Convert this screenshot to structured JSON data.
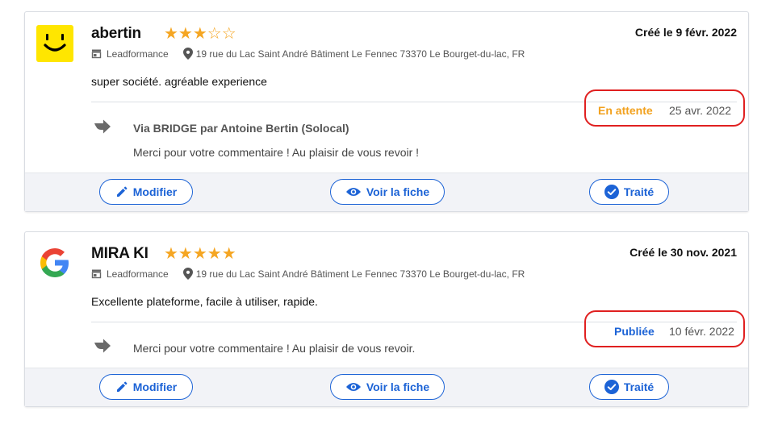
{
  "colors": {
    "accent": "#1c63d6",
    "pending": "#f2a11e",
    "highlight": "#e02020",
    "star": "#f5a623"
  },
  "reviews": [
    {
      "author": "abertin",
      "source_icon": "smiley-logo-icon",
      "rating": 3,
      "rating_max": 5,
      "stars_display": {
        "full": "★★★",
        "empty": "☆☆"
      },
      "created": "Créé le 9 févr. 2022",
      "location_name": "Leadformance",
      "address": "19 rue du Lac Saint André Bâtiment Le Fennec 73370 Le Bourget-du-lac, FR",
      "text": "super société. agréable experience",
      "reply": {
        "status": "En attente",
        "date": "25 avr. 2022",
        "via": "Via BRIDGE par Antoine Bertin (Solocal)",
        "text": "Merci pour votre commentaire ! Au plaisir de vous revoir !"
      }
    },
    {
      "author": "MIRA KI",
      "source_icon": "google-logo-icon",
      "rating": 5,
      "rating_max": 5,
      "stars_display": {
        "full": "★★★★★",
        "empty": ""
      },
      "created": "Créé le 30 nov. 2021",
      "location_name": "Leadformance",
      "address": "19 rue du Lac Saint André Bâtiment Le Fennec 73370 Le Bourget-du-lac, FR",
      "text": "Excellente plateforme, facile à utiliser, rapide.",
      "reply": {
        "status": "Publiée",
        "date": "10 févr. 2022",
        "text": "Merci pour votre commentaire ! Au plaisir de vous revoir."
      }
    }
  ],
  "actions": {
    "edit_label": "Modifier",
    "view_label": "Voir la fiche",
    "done_label": "Traité"
  }
}
